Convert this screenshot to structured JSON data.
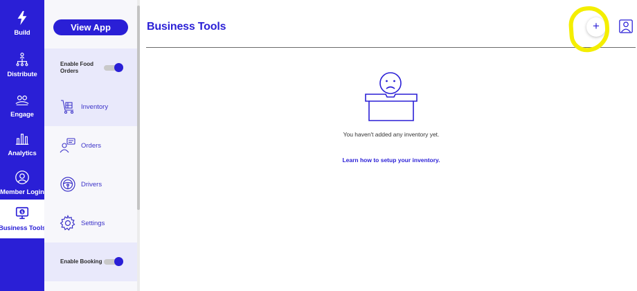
{
  "rail": {
    "items": [
      {
        "label": "Build",
        "icon": "lightning-icon"
      },
      {
        "label": "Distribute",
        "icon": "distribute-icon"
      },
      {
        "label": "Engage",
        "icon": "engage-icon"
      },
      {
        "label": "Analytics",
        "icon": "analytics-icon"
      },
      {
        "label": "Member Login",
        "icon": "member-login-icon"
      },
      {
        "label": "Business Tools",
        "icon": "business-tools-icon",
        "active": true
      }
    ]
  },
  "panel": {
    "view_app_label": "View App",
    "enable_food_orders": {
      "label": "Enable Food Orders",
      "on": true
    },
    "nav": [
      {
        "label": "Inventory",
        "icon": "inventory-icon",
        "selected": true
      },
      {
        "label": "Orders",
        "icon": "orders-icon"
      },
      {
        "label": "Drivers",
        "icon": "steering-wheel-icon"
      },
      {
        "label": "Settings",
        "icon": "gear-icon"
      }
    ],
    "enable_booking": {
      "label": "Enable Booking",
      "on": true
    }
  },
  "main": {
    "title": "Business Tools",
    "add_label": "+",
    "empty_message": "You haven't added any inventory yet.",
    "learn_link": "Learn how to setup your inventory."
  },
  "colors": {
    "accent": "#2a1fd6",
    "highlight": "#f4ee00",
    "panel_bg": "#f7f7fb",
    "panel_selected": "#e9e9fb"
  }
}
